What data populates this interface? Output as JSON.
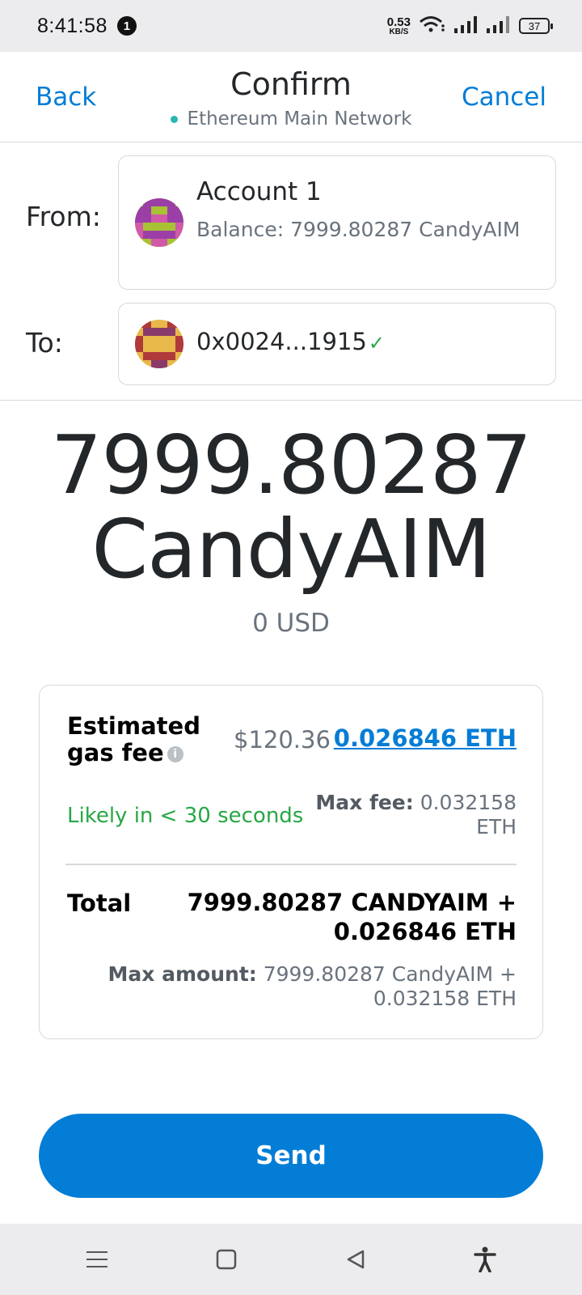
{
  "status_bar": {
    "time": "8:41:58",
    "notification_count": "1",
    "net_speed_value": "0.53",
    "net_speed_unit": "KB/S",
    "battery": "37"
  },
  "header": {
    "back_label": "Back",
    "title": "Confirm",
    "network": "Ethereum Main Network",
    "cancel_label": "Cancel"
  },
  "from": {
    "label": "From:",
    "account_name": "Account 1",
    "balance": "Balance: 7999.80287 CandyAIM"
  },
  "to": {
    "label": "To:",
    "address": "0x0024...1915",
    "verified_mark": "✓"
  },
  "amount": {
    "value": "7999.80287",
    "token": "CandyAIM",
    "fiat": "0 USD"
  },
  "fee": {
    "label": "Estimated gas fee",
    "info_icon": "i",
    "fiat": "$120.36",
    "eth": "0.026846 ETH",
    "likely": "Likely in < 30 seconds",
    "max_fee_label": "Max fee:",
    "max_fee_value": "0.032158 ETH"
  },
  "total": {
    "label": "Total",
    "value_line1": "7999.80287 CANDYAIM +",
    "value_line2": "0.026846 ETH",
    "max_amount_label": "Max amount:",
    "max_amount_value": "7999.80287 CandyAIM + 0.032158 ETH"
  },
  "send_button": {
    "label": "Send"
  },
  "colors": {
    "accent": "#037dd6",
    "success": "#28a745",
    "network_dot": "#29b6af",
    "text_primary": "#24272a",
    "text_muted": "#6a737d"
  },
  "icons": {
    "wifi": "wifi-icon",
    "signal": "signal-icon",
    "nav_menu": "menu-icon",
    "nav_home": "home-icon",
    "nav_back": "back-triangle-icon",
    "accessibility": "accessibility-icon"
  }
}
